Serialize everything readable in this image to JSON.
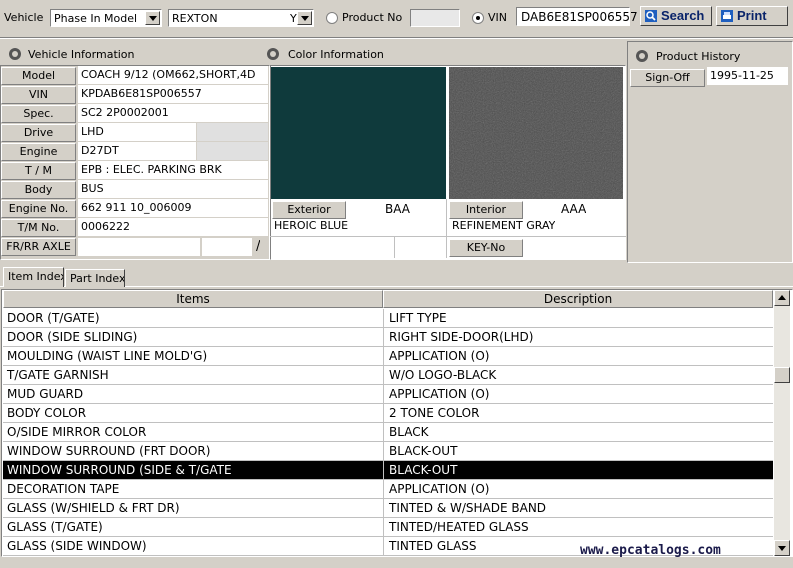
{
  "toolbar": {
    "vehicle_label": "Vehicle",
    "search_mode": "Phase In Model",
    "model": "REXTON",
    "model_suffix": "Y",
    "product_no_label": "Product No",
    "product_no_value": "",
    "vin_label": "VIN",
    "vin_value": "DAB6E81SP006557",
    "search_label": "Search",
    "print_label": "Print"
  },
  "vehicle_info": {
    "title": "Vehicle Information",
    "model_label": "Model",
    "model_value": "COACH 9/12 (OM662,SHORT,4D",
    "vin_label": "VIN",
    "vin_value": "KPDAB6E81SP006557",
    "spec_label": "Spec.",
    "spec_value": "SC2 2P0002001",
    "drive_label": "Drive",
    "drive_value": "LHD",
    "engine_label": "Engine",
    "engine_value": "D27DT",
    "tm_label": "T / M",
    "tm_value": "EPB : ELEC. PARKING BRK",
    "body_label": "Body",
    "body_value": "BUS",
    "engine_no_label": "Engine No.",
    "engine_no_value": "662 911 10_006009",
    "tm_no_label": "T/M No.",
    "tm_no_value": "0006222",
    "axle_label": "FR/RR AXLE",
    "axle_sep": "/"
  },
  "color_info": {
    "title": "Color Information",
    "exterior_label": "Exterior",
    "exterior_code": "BAA",
    "exterior_name": "HEROIC BLUE",
    "exterior_color": "#0f3a3c",
    "interior_label": "Interior",
    "interior_code": "AAA",
    "interior_name": "REFINEMENT GRAY",
    "interior_color": "#4a4a4a",
    "key_no_label": "KEY-No"
  },
  "product_history": {
    "title": "Product History",
    "signoff_label": "Sign-Off",
    "signoff_date": "1995-11-25"
  },
  "tabs": [
    {
      "label": "Item Index"
    },
    {
      "label": "Part Index"
    }
  ],
  "table": {
    "columns": [
      "Items",
      "Description"
    ],
    "rows": [
      {
        "item": "DOOR (T/GATE)",
        "desc": "LIFT TYPE"
      },
      {
        "item": "DOOR (SIDE SLIDING)",
        "desc": "RIGHT SIDE-DOOR(LHD)"
      },
      {
        "item": "MOULDING (WAIST LINE MOLD'G)",
        "desc": "APPLICATION (O)"
      },
      {
        "item": "T/GATE GARNISH",
        "desc": "W/O LOGO-BLACK"
      },
      {
        "item": "MUD GUARD",
        "desc": "APPLICATION (O)"
      },
      {
        "item": "BODY COLOR",
        "desc": "2 TONE COLOR"
      },
      {
        "item": "O/SIDE MIRROR COLOR",
        "desc": "BLACK"
      },
      {
        "item": "WINDOW SURROUND (FRT DOOR)",
        "desc": "BLACK-OUT"
      },
      {
        "item": "WINDOW SURROUND (SIDE & T/GATE",
        "desc": "BLACK-OUT"
      },
      {
        "item": "DECORATION TAPE",
        "desc": "APPLICATION (O)"
      },
      {
        "item": "GLASS (W/SHIELD & FRT DR)",
        "desc": "TINTED & W/SHADE BAND"
      },
      {
        "item": "GLASS (T/GATE)",
        "desc": "TINTED/HEATED GLASS"
      },
      {
        "item": "GLASS (SIDE WINDOW)",
        "desc": "TINTED GLASS"
      }
    ]
  },
  "watermark": "www.epcatalogs.com"
}
